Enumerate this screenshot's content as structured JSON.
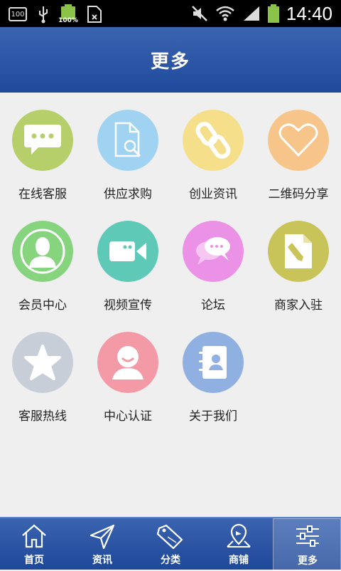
{
  "status_bar": {
    "time": "14:40",
    "battery_percent": "100%",
    "battery_left_label": "100",
    "icons": [
      "usb-icon",
      "battery-icon",
      "sim-icon",
      "mute-icon",
      "wifi-icon",
      "signal-icon"
    ]
  },
  "header": {
    "title": "更多"
  },
  "grid": {
    "items": [
      {
        "label": "在线客服",
        "color": "#b6cf6a",
        "icon": "chat-bubble-icon"
      },
      {
        "label": "供应求购",
        "color": "#9fd3f1",
        "icon": "document-search-icon"
      },
      {
        "label": "创业资讯",
        "color": "#f5df8a",
        "icon": "link-icon"
      },
      {
        "label": "二维码分享",
        "color": "#f7c58a",
        "icon": "heart-icon"
      },
      {
        "label": "会员中心",
        "color": "#86d47e",
        "icon": "user-silhouette-icon"
      },
      {
        "label": "视频宣传",
        "color": "#5fc9b8",
        "icon": "video-camera-icon"
      },
      {
        "label": "论坛",
        "color": "#eb91e6",
        "icon": "speech-bubbles-icon"
      },
      {
        "label": "商家入驻",
        "color": "#c9c459",
        "icon": "edit-document-icon"
      },
      {
        "label": "客服热线",
        "color": "#c7ced8",
        "icon": "star-icon"
      },
      {
        "label": "中心认证",
        "color": "#f49aa6",
        "icon": "smile-user-icon"
      },
      {
        "label": "关于我们",
        "color": "#8fb0e0",
        "icon": "contacts-book-icon"
      }
    ]
  },
  "tabbar": {
    "tabs": [
      {
        "label": "首页",
        "icon": "home-icon"
      },
      {
        "label": "资讯",
        "icon": "paper-plane-icon"
      },
      {
        "label": "分类",
        "icon": "sale-tag-icon"
      },
      {
        "label": "商铺",
        "icon": "map-pin-icon"
      },
      {
        "label": "更多",
        "icon": "sliders-icon",
        "active": true
      }
    ]
  }
}
